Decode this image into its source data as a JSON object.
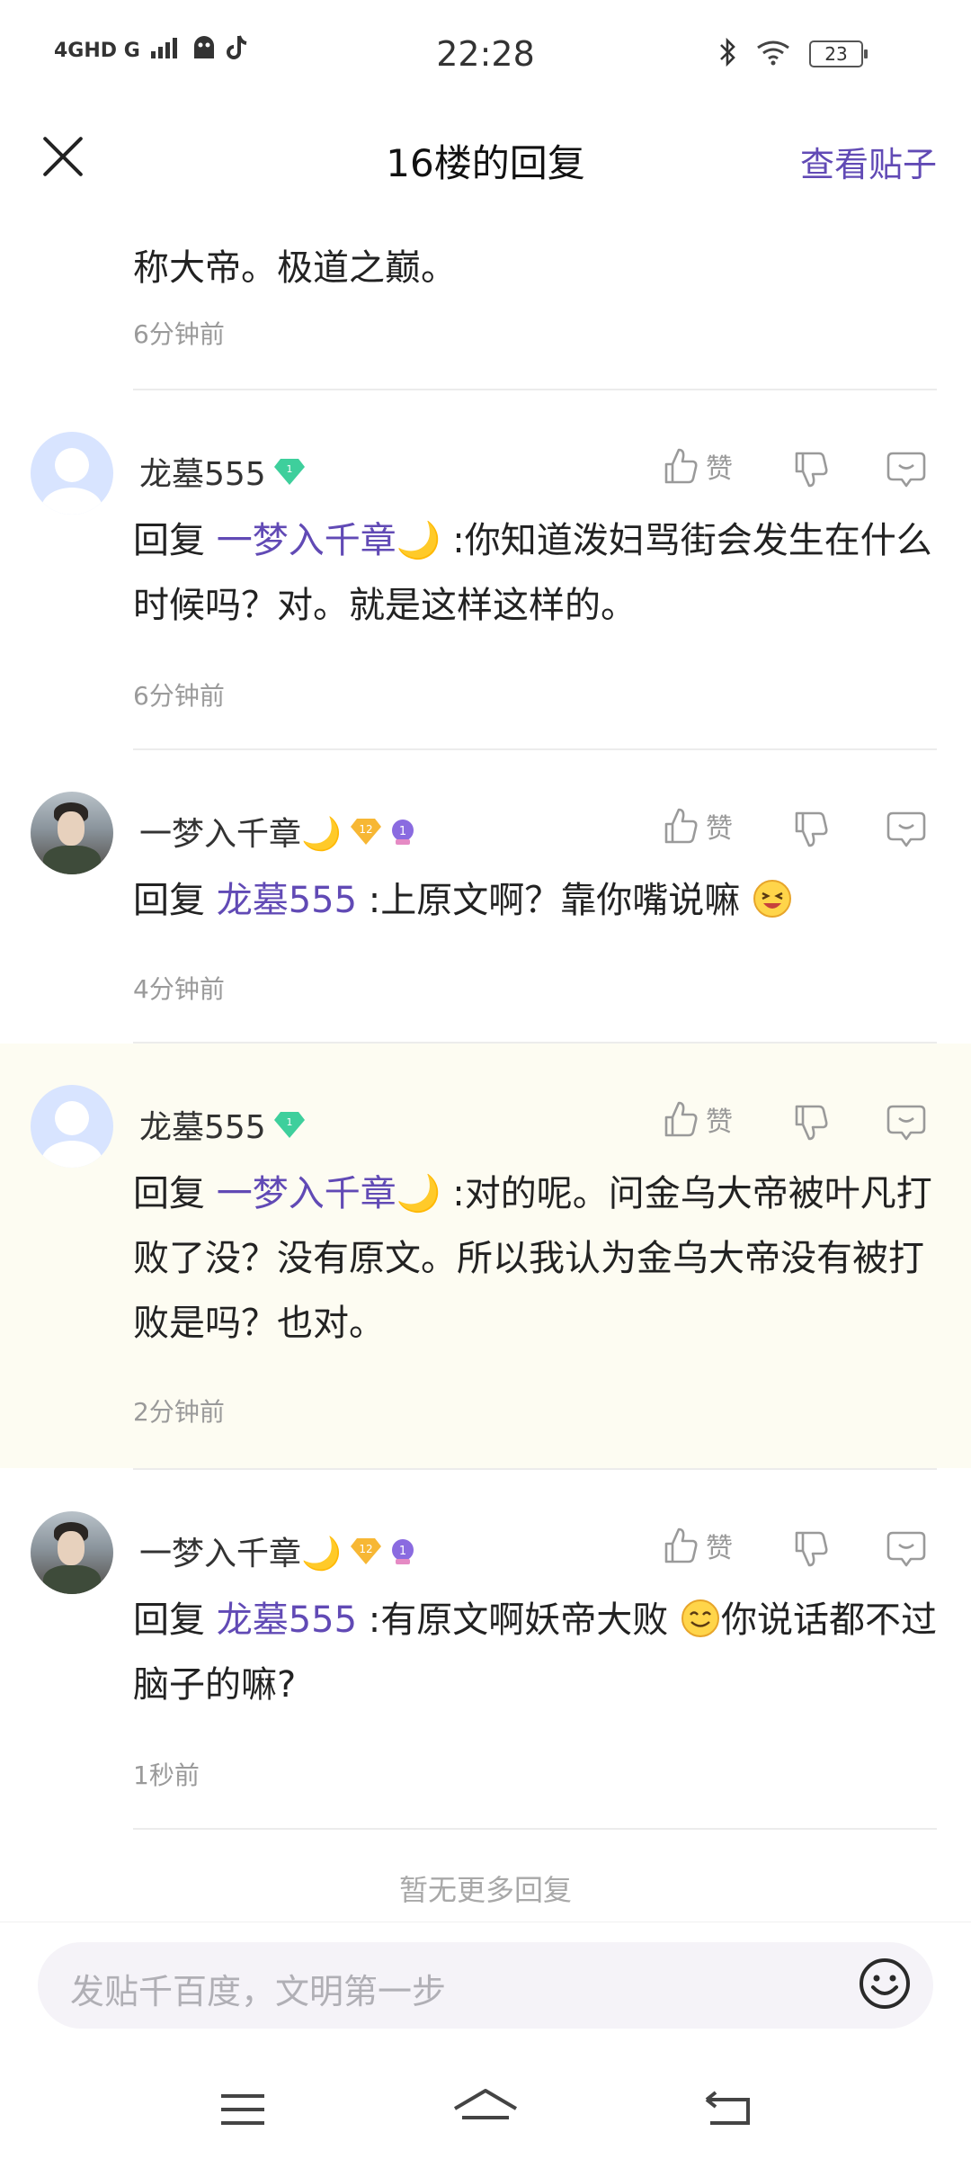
{
  "status_bar": {
    "network": "4GHD G",
    "time": "22:28",
    "battery": "23"
  },
  "header": {
    "title": "16楼的回复",
    "view_post": "查看贴子"
  },
  "partial_reply": {
    "text": "称大帝。极道之巅。",
    "time": "6分钟前"
  },
  "replies": [
    {
      "user": "龙墓555",
      "like_label": "赞",
      "reply_prefix": "回复",
      "mention": "一梦入千章🌙",
      "text": " :你知道泼妇骂街会发生在什么时候吗？对。就是这样这样的。",
      "time": "6分钟前"
    },
    {
      "user": "一梦入千章🌙",
      "like_label": "赞",
      "reply_prefix": "回复",
      "mention": "龙墓555",
      "text": " :上原文啊？靠你嘴说嘛",
      "time": "4分钟前",
      "level": "12"
    },
    {
      "user": "龙墓555",
      "like_label": "赞",
      "reply_prefix": "回复",
      "mention": "一梦入千章🌙",
      "text": " :对的呢。问金乌大帝被叶凡打败了没？没有原文。所以我认为金乌大帝没有被打败是吗？也对。",
      "time": "2分钟前"
    },
    {
      "user": "一梦入千章🌙",
      "like_label": "赞",
      "reply_prefix": "回复",
      "mention": "龙墓555",
      "text_a": " :有原文啊妖帝大败",
      "text_b": "你说话都不过脑子的嘛?",
      "time": "1秒前",
      "level": "12"
    }
  ],
  "no_more": "暂无更多回复",
  "input": {
    "placeholder": "发贴千百度，文明第一步"
  },
  "colors": {
    "accent": "#614ab5",
    "highlight_bg": "#fdfcf2"
  }
}
